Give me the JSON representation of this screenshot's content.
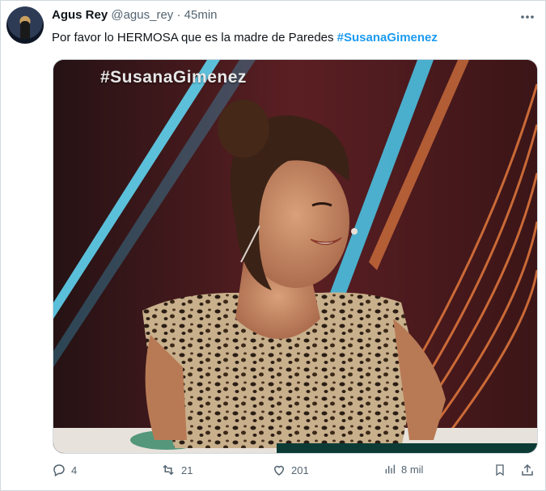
{
  "tweet": {
    "author_name": "Agus Rey",
    "author_handle": "@agus_rey",
    "separator": "·",
    "time": "45min",
    "more_icon": "more-horizontal-icon",
    "text_prefix": "Por favor lo HERMOSA que es la madre de Paredes ",
    "hashtag": "#SusanaGimenez"
  },
  "media": {
    "overlay_text": "#SusanaGimenez"
  },
  "actions": {
    "reply_count": "4",
    "retweet_count": "21",
    "like_count": "201",
    "views_count": "8 mil"
  },
  "colors": {
    "accent": "#1d9bf0",
    "muted": "#536471",
    "text": "#0f1419"
  }
}
